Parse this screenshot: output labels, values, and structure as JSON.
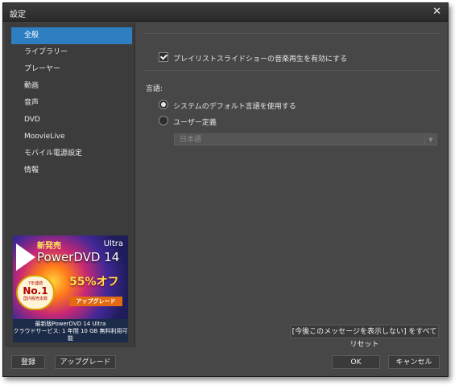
{
  "window": {
    "title": "設定"
  },
  "sidebar": {
    "items": [
      {
        "label": "全般"
      },
      {
        "label": "ライブラリー"
      },
      {
        "label": "プレーヤー"
      },
      {
        "label": "動画"
      },
      {
        "label": "音声"
      },
      {
        "label": "DVD"
      },
      {
        "label": "MoovieLive"
      },
      {
        "label": "モバイル電源設定"
      },
      {
        "label": "情報"
      }
    ],
    "active_index": 0
  },
  "ad": {
    "new_release": "新発売",
    "edition": "Ultra",
    "product": "PowerDVD 14",
    "discount": "55%オフ",
    "badge_years": "7年連続",
    "badge_rank": "No.1",
    "badge_sub": "国内販売本数",
    "upgrade": "アップグレード",
    "caption_line1": "最新版PowerDVD 14 Ultra",
    "caption_line2": "クラウドサービス: 1 年間 10 GB 無料利用可能"
  },
  "general": {
    "slideshow_music": {
      "label": "プレイリストスライドショーの音楽再生を有効にする",
      "checked": true
    },
    "language_heading": "言語:",
    "language_options": [
      {
        "label": "システムのデフォルト言語を使用する",
        "selected": true
      },
      {
        "label": "ユーザー定義",
        "selected": false
      }
    ],
    "language_select": {
      "value": "日本語"
    },
    "reset_messages_button": "[今後このメッセージを表示しない] をすべてリセット"
  },
  "footer": {
    "register_button": "登録",
    "upgrade_button": "アップグレード",
    "ok_button": "OK",
    "cancel_button": "キャンセル"
  },
  "colors": {
    "window_bg": "#474747",
    "sidebar_bg": "#3c3c3c",
    "accent": "#2d7fc2"
  },
  "icons": {
    "close": "close-icon",
    "dropdown": "chevron-down-icon",
    "play": "play-icon"
  }
}
